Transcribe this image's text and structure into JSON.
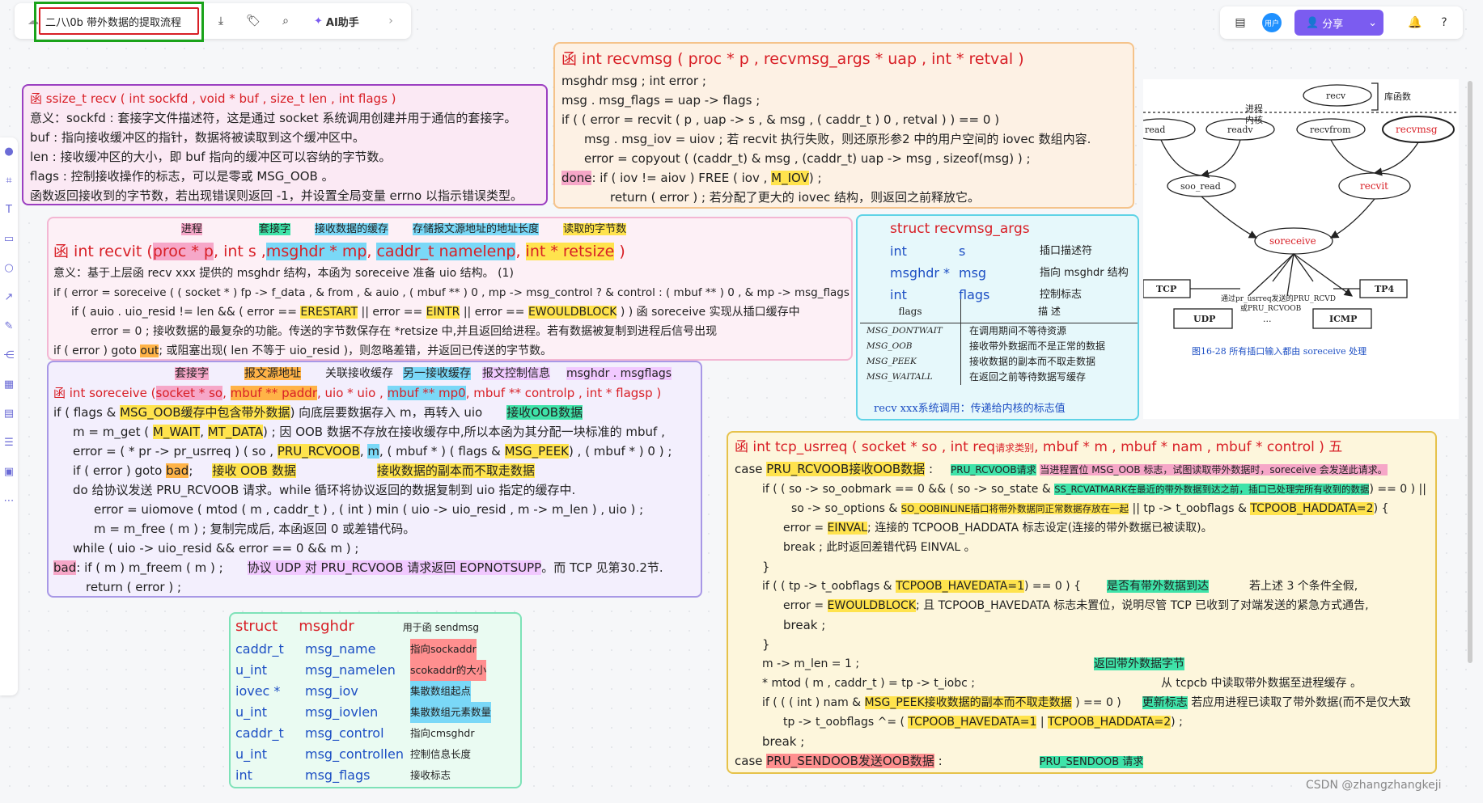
{
  "toolbar": {
    "doc_title": "二八\\0b 带外数据的提取流程",
    "ai_label": "AI助手",
    "user_badge": "用户",
    "share_label": "分享"
  },
  "icons": {
    "cloud": "cloud-icon",
    "download": "download-icon",
    "tag": "tag-icon",
    "search": "search-icon",
    "calendar": "calendar-icon",
    "bell": "bell-icon",
    "help": "help-icon",
    "chevron": "chevron-right-icon"
  },
  "colors": {
    "accent": "#7b5cf0",
    "green_border": "#1aa31a",
    "red_box": "#d81f26"
  },
  "watermark": "CSDN @zhangzhangkeji",
  "card1": {
    "sig": "函 ssize_t recv ( int sockfd , void * buf , size_t len , int flags )",
    "l1": "意义：sockfd : 套接字文件描述符，这是通过 socket 系统调用创建并用于通信的套接字。",
    "l2": "buf : 指向接收缓冲区的指针，数据将被读取到这个缓冲区中。",
    "l3": "len : 接收缓冲区的大小，即 buf 指向的缓冲区可以容纳的字节数。",
    "l4": "flags : 控制接收操作的标志，可以是零或 MSG_OOB 。",
    "l5": "函数返回接收到的字节数，若出现错误则返回 -1，并设置全局变量 errno 以指示错误类型。"
  },
  "card2": {
    "sig": "函 int recvmsg ( proc * p , recvmsg_args * uap , int * retval )",
    "l1": "msghdr msg ;      int error ;",
    "l2": "msg . msg_flags = uap -> flags ;",
    "l3": "if ( ( error = recvit ( p , uap -> s , & msg , ( caddr_t ) 0 , retval ) ) == 0 )",
    "l4": "msg . msg_iov = uiov ;      若 recvit 执行失败，则还原形参2 中的用户空间的 iovec 数组内容.",
    "l5": "error = copyout ( (caddr_t) & msg , (caddr_t) uap -> msg , sizeof(msg) ) ;",
    "l6a": "done",
    "l6b": ": if ( iov != aiov )    FREE ( iov ,",
    "l6c": "M_IOV",
    "l6d": ") ;",
    "l7": "return ( error ) ;       若分配了更大的 iovec 结构，则返回之前释放它。"
  },
  "card3": {
    "heads": [
      "进程",
      "套接字",
      "接收数据的缓存",
      "存储报文源地址的地址长度",
      "读取的字节数"
    ],
    "sig_a": "函 int recvit (",
    "sig_p": "proc * p",
    "sig_s": ", int s ,",
    "sig_m": "msghdr * mp",
    "sig_n": "caddr_t namelenp",
    "sig_r": "int * retsize",
    "l1": "意义：基于上层函 recv xxx 提供的 msghdr 结构，本函为 soreceive 准备 uio 结构。            (1)",
    "l2": "if ( error = soreceive ( ( socket * ) fp -> f_data , & from , & auio , ( mbuf ** ) 0 , mp -> msg_control ? & control : ( mbuf ** ) 0 , & mp -> msg_flags ) )",
    "l3a": "if ( auio . uio_resid != len && ( error ==",
    "l3b": "ERESTART",
    "l3c": "|| error ==",
    "l3d": "EINTR",
    "l3e": "|| error ==",
    "l3f": "EWOULDBLOCK",
    "l3g": ") )    函 soreceive 实现从插口缓存中",
    "l4": "error = 0 ;                  接收数据的最复杂的功能。传送的字节数保存在 *retsize 中,并且返回给进程。若有数据被复制到进程后信号出现",
    "l5a": "if ( error )    goto",
    "l5b": "out",
    "l5c": ";          或阻塞出现( len 不等于 uio_resid )，则忽略差错，并返回已传送的字节数。"
  },
  "card4": {
    "heads": [
      "套接字",
      "报文源地址",
      "关联接收缓存",
      "另一接收缓存",
      "报文控制信息",
      "msghdr . msgflags"
    ],
    "sig_a": "函 int soreceive (",
    "sig_1": "socket * so",
    "sig_2": "mbuf ** paddr",
    "sig_3": ", uio * uio ,",
    "sig_4": "mbuf ** mp0",
    "sig_5": ", mbuf ** controlp , int * flagsp )",
    "l1a": "if ( flags &",
    "l1b": "MSG_OOB缓存中包含带外数据",
    "l1c": ") 向底层要数据存入 m，再转入 uio",
    "l1d": "接收OOB数据",
    "l2a": "m = m_get (",
    "l2b": "M_WAIT",
    "l2c": "MT_DATA",
    "l2d": ") ; 因 OOB 数据不存放在接收缓存中,所以本函为其分配一块标准的 mbuf ,",
    "l3a": "error = ( * pr -> pr_usrreq ) ( so ,",
    "l3b": "PRU_RCVOOB",
    "l3c": "m",
    "l3d": ", ( mbuf * ) ( flags &",
    "l3e": "MSG_PEEK",
    "l3f": ") , ( mbuf * ) 0 ) ;",
    "l4a": "if ( error )    goto",
    "l4b": "bad",
    "l4c": ";",
    "l4d": "接收 OOB 数据",
    "l4e": "接收数据的副本而不取走数据",
    "l5": "do                    给协议发送 PRU_RCVOOB 请求。while 循环将协议返回的数据复制到 uio 指定的缓存中.",
    "l6": "error = uiomove ( mtod ( m , caddr_t ) , ( int ) min ( uio -> uio_resid , m -> m_len ) , uio ) ;",
    "l7": "m = m_free ( m ) ;                       复制完成后, 本函返回 0 或差错代码。",
    "l8": "while ( uio -> uio_resid && error == 0 && m ) ;",
    "l9a": "bad",
    "l9b": ": if ( m )    m_freem ( m ) ;",
    "l9c": "协议 UDP 对 PRU_RCVOOB 请求返回 EOPNOTSUPP",
    "l9d": "。而 TCP 见第30.2节.",
    "l10": "return ( error ) ;"
  },
  "card5": {
    "head": "struct   recvmsg_args",
    "rows": [
      [
        "int",
        "s",
        "插口描述符"
      ],
      [
        "msghdr *",
        "msg",
        "指向 msghdr 结构"
      ],
      [
        "int",
        "flags",
        "控制标志"
      ]
    ],
    "th": [
      "flags",
      "描   述"
    ],
    "trows": [
      [
        "MSG_DONTWAIT",
        "在调用期间不等待资源"
      ],
      [
        "MSG_OOB",
        "接收带外数据而不是正常的数据"
      ],
      [
        "MSG_PEEK",
        "接收数据的副本而不取走数据"
      ],
      [
        "MSG_WAITALL",
        "在返回之前等待数据写缓存"
      ]
    ],
    "foot": "recv xxx系统调用：传递给内核的标志值"
  },
  "card6": {
    "head_a": "struct",
    "head_b": "msghdr",
    "head_c": "用于函 sendmsg",
    "rows": [
      [
        "caddr_t",
        "msg_name",
        "指向sockaddr"
      ],
      [
        "u_int",
        "msg_namelen",
        "scokaddr的大小"
      ],
      [
        "iovec *",
        "msg_iov",
        "集散数组起点"
      ],
      [
        "u_int",
        "msg_iovlen",
        "集散数组元素数量"
      ],
      [
        "caddr_t",
        "msg_control",
        "指向cmsghdr"
      ],
      [
        "u_int",
        "msg_controllen",
        "控制信息长度"
      ],
      [
        "int",
        "msg_flags",
        "接收标志"
      ]
    ]
  },
  "card7": {
    "sig_a": "函 int tcp_usrreq ( socket * so , int req",
    "sig_b": "请求类别",
    "sig_c": ", mbuf * m , mbuf * nam , mbuf * control )   五",
    "c1a": "case",
    "c1b": "PRU_RCVOOB接收OOB数据",
    "c1c": ":",
    "c1d": "PRU_RCVOOB请求",
    "c1e": "当进程置位 MSG_OOB 标志，试图读取带外数据时，soreceive 会发送此请求。",
    "l1a": "if ( ( so -> so_oobmark == 0 && ( so -> so_state &",
    "l1b": "SS_RCVATMARK在最近的带外数据到达之前，插口已处理完所有收到的数据",
    "l1c": ") == 0 ) ||",
    "l2a": "so -> so_options &",
    "l2b": "SO_OOBINLINE插口将带外数据同正常数据存放在一起",
    "l2c": "|| tp -> t_oobflags &",
    "l2d": "TCPOOB_HADDATA=2",
    "l2e": ") {",
    "l3a": "error =",
    "l3b": "EINVAL",
    "l3c": ";       连接的 TCPOOB_HADDATA 标志设定(连接的带外数据已被读取)。",
    "l4": "break ;                        此时返回差错代码 EINVAL 。",
    "l5": "}",
    "l6a": "if ( ( tp -> t_oobflags &",
    "l6b": "TCPOOB_HAVEDATA=1",
    "l6c": ") == 0 ) {",
    "l6d": "是否有带外数据到达",
    "l6e": "若上述 3 个条件全假,",
    "l7a": "error =",
    "l7b": "EWOULDBLOCK",
    "l7c": ";    且 TCPOOB_HAVEDATA 标志未置位，说明尽管 TCP 已收到了对端发送的紧急方式通告,",
    "l8": "break ;",
    "l9": "}",
    "l10a": "m -> m_len = 1 ;",
    "l10b": "返回带外数据字节",
    "l11a": "* mtod ( m , caddr_t ) = tp -> t_iobc ;",
    "l11b": "从 tcpcb 中读取带外数据至进程缓存 。",
    "l12a": "if ( ( ( int ) nam &",
    "l12b": "MSG_PEEK接收数据的副本而不取走数据",
    "l12c": ") == 0 )",
    "l12d": "更新标志",
    "l12e": "若应用进程已读取了带外数据(而不是仅大致",
    "l13a": "tp -> t_oobflags ^= (",
    "l13b": "TCPOOB_HAVEDATA=1",
    "l13c": "|",
    "l13d": "TCPOOB_HADDATA=2",
    "l13e": ") ;",
    "l14": "break ;",
    "c2a": "case",
    "c2b": "PRU_SENDOOB发送OOB数据",
    "c2c": ":",
    "c2d": "PRU_SENDOOB 请求"
  },
  "figure": {
    "layer_top": "库函数",
    "layer_a": "进程",
    "layer_b": "内核",
    "nodes": [
      "recv",
      "read",
      "readv",
      "recvfrom",
      "recvmsg",
      "soo_read",
      "recvit",
      "soreceive",
      "TCP",
      "TP4",
      "UDP",
      "ICMP",
      "..."
    ],
    "note1": "通过pr_usrreq发送的PRU_RCVD",
    "note2": "或PRU_RCVOOB",
    "caption": "图16-28  所有插口输入都由 soreceive 处理"
  }
}
